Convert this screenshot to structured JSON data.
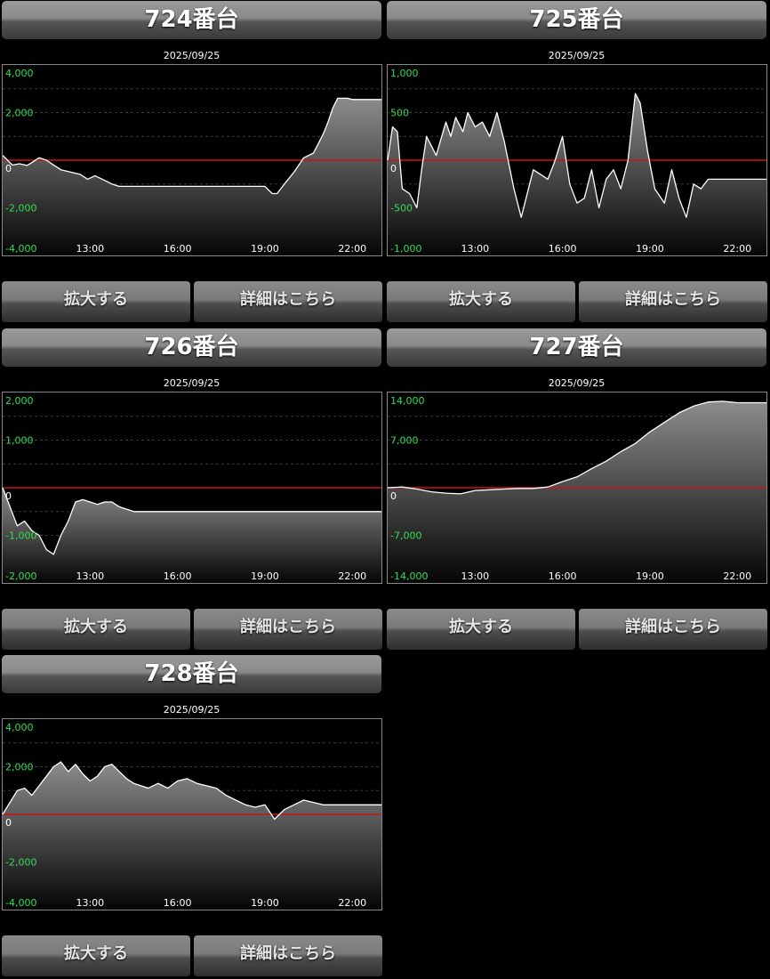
{
  "buttons": {
    "zoom": "拡大する",
    "detail": "詳細はこちら"
  },
  "colors": {
    "ytick": "#33dd55",
    "zero_line": "#c81414",
    "grid": "#3a3a3a",
    "series": "#ffffff",
    "title_text": "#ffffff"
  },
  "panels": [
    {
      "title": "724番台",
      "date": "2025/09/25",
      "chart_data": {
        "type": "area",
        "title": "724番台",
        "date": "2025/09/25",
        "x_ticks": [
          "13:00",
          "16:00",
          "19:00",
          "22:00"
        ],
        "x_range": [
          "10:00",
          "23:00"
        ],
        "y_ticks": [
          4000,
          2000,
          0,
          -2000,
          -4000
        ],
        "y_tick_labels": [
          "4,000",
          "2,000",
          "0",
          "-2,000",
          "-4,000"
        ],
        "ylim": [
          -4000,
          4000
        ],
        "grid": true,
        "zero_line": true,
        "x": [
          "10:00",
          "10:20",
          "10:35",
          "10:50",
          "11:00",
          "11:15",
          "11:30",
          "11:45",
          "12:00",
          "12:20",
          "12:40",
          "12:55",
          "13:10",
          "13:30",
          "13:45",
          "14:00",
          "15:00",
          "16:00",
          "17:00",
          "18:00",
          "19:00",
          "19:15",
          "19:25",
          "19:40",
          "20:00",
          "20:20",
          "20:40",
          "20:50",
          "21:00",
          "21:10",
          "21:20",
          "21:30",
          "21:50",
          "22:00",
          "22:30",
          "23:00"
        ],
        "y": [
          200,
          -200,
          -150,
          -220,
          -100,
          100,
          0,
          -200,
          -400,
          -500,
          -600,
          -800,
          -650,
          -850,
          -1000,
          -1100,
          -1100,
          -1100,
          -1100,
          -1100,
          -1100,
          -1400,
          -1400,
          -1000,
          -500,
          100,
          300,
          700,
          1100,
          1600,
          2200,
          2600,
          2600,
          2550,
          2550,
          2550
        ]
      }
    },
    {
      "title": "725番台",
      "date": "2025/09/25",
      "chart_data": {
        "type": "area",
        "title": "725番台",
        "date": "2025/09/25",
        "x_ticks": [
          "13:00",
          "16:00",
          "19:00",
          "22:00"
        ],
        "x_range": [
          "10:00",
          "23:00"
        ],
        "y_ticks": [
          1000,
          500,
          0,
          -500,
          -1000
        ],
        "y_tick_labels": [
          "1,000",
          "500",
          "0",
          "-500",
          "-1,000"
        ],
        "ylim": [
          -1000,
          1000
        ],
        "grid": true,
        "zero_line": true,
        "x": [
          "10:00",
          "10:10",
          "10:20",
          "10:30",
          "10:45",
          "11:00",
          "11:10",
          "11:20",
          "11:40",
          "12:00",
          "12:10",
          "12:20",
          "12:35",
          "12:45",
          "13:00",
          "13:15",
          "13:30",
          "13:45",
          "14:00",
          "14:20",
          "14:35",
          "15:00",
          "15:30",
          "15:45",
          "16:00",
          "16:15",
          "16:30",
          "16:45",
          "17:00",
          "17:15",
          "17:30",
          "17:45",
          "18:00",
          "18:15",
          "18:30",
          "18:40",
          "18:55",
          "19:10",
          "19:30",
          "19:45",
          "20:00",
          "20:15",
          "20:30",
          "20:45",
          "21:00",
          "21:15",
          "21:30",
          "23:00"
        ],
        "y": [
          0,
          350,
          300,
          -300,
          -350,
          -500,
          -100,
          250,
          50,
          400,
          250,
          450,
          300,
          500,
          350,
          400,
          250,
          500,
          200,
          -300,
          -600,
          -100,
          -200,
          0,
          250,
          -250,
          -450,
          -400,
          -100,
          -500,
          -200,
          -100,
          -300,
          0,
          700,
          600,
          100,
          -300,
          -450,
          -100,
          -400,
          -600,
          -250,
          -300,
          -200,
          -200,
          -200,
          -200
        ]
      }
    },
    {
      "title": "726番台",
      "date": "2025/09/25",
      "chart_data": {
        "type": "area",
        "title": "726番台",
        "date": "2025/09/25",
        "x_ticks": [
          "13:00",
          "16:00",
          "19:00",
          "22:00"
        ],
        "x_range": [
          "10:00",
          "23:00"
        ],
        "y_ticks": [
          2000,
          1000,
          0,
          -1000,
          -2000
        ],
        "y_tick_labels": [
          "2,000",
          "1,000",
          "0",
          "-1,000",
          "-2,000"
        ],
        "ylim": [
          -2000,
          2000
        ],
        "grid": true,
        "zero_line": true,
        "x": [
          "10:00",
          "10:15",
          "10:30",
          "10:45",
          "11:00",
          "11:15",
          "11:30",
          "11:45",
          "12:00",
          "12:15",
          "12:30",
          "12:45",
          "13:00",
          "13:15",
          "13:30",
          "13:45",
          "14:00",
          "14:15",
          "14:30",
          "15:00",
          "16:00",
          "17:00",
          "18:00",
          "19:00",
          "20:00",
          "21:00",
          "22:00",
          "23:00"
        ],
        "y": [
          0,
          -400,
          -800,
          -700,
          -900,
          -1000,
          -1300,
          -1400,
          -1000,
          -700,
          -300,
          -250,
          -300,
          -350,
          -300,
          -300,
          -400,
          -450,
          -500,
          -500,
          -500,
          -500,
          -500,
          -500,
          -500,
          -500,
          -500,
          -500
        ]
      }
    },
    {
      "title": "727番台",
      "date": "2025/09/25",
      "chart_data": {
        "type": "area",
        "title": "727番台",
        "date": "2025/09/25",
        "x_ticks": [
          "13:00",
          "16:00",
          "19:00",
          "22:00"
        ],
        "x_range": [
          "10:00",
          "23:00"
        ],
        "y_ticks": [
          14000,
          7000,
          0,
          -7000,
          -14000
        ],
        "y_tick_labels": [
          "14,000",
          "7,000",
          "0",
          "-7,000",
          "-14,000"
        ],
        "ylim": [
          -14000,
          14000
        ],
        "grid": true,
        "zero_line": true,
        "x": [
          "10:00",
          "10:30",
          "11:00",
          "11:30",
          "12:00",
          "12:30",
          "13:00",
          "13:30",
          "14:00",
          "14:30",
          "15:00",
          "15:30",
          "16:00",
          "16:30",
          "17:00",
          "17:30",
          "18:00",
          "18:30",
          "19:00",
          "19:30",
          "20:00",
          "20:30",
          "21:00",
          "21:30",
          "22:00",
          "23:00"
        ],
        "y": [
          0,
          100,
          -200,
          -600,
          -800,
          -900,
          -400,
          -300,
          -200,
          -100,
          -100,
          100,
          900,
          1600,
          2800,
          3900,
          5300,
          6500,
          8200,
          9600,
          11000,
          12000,
          12600,
          12700,
          12500,
          12500
        ]
      }
    },
    {
      "title": "728番台",
      "date": "2025/09/25",
      "chart_data": {
        "type": "area",
        "title": "728番台",
        "date": "2025/09/25",
        "x_ticks": [
          "13:00",
          "16:00",
          "19:00",
          "22:00"
        ],
        "x_range": [
          "10:00",
          "23:00"
        ],
        "y_ticks": [
          4000,
          2000,
          0,
          -2000,
          -4000
        ],
        "y_tick_labels": [
          "4,000",
          "2,000",
          "0",
          "-2,000",
          "-4,000"
        ],
        "ylim": [
          -4000,
          4000
        ],
        "grid": true,
        "zero_line": true,
        "x": [
          "10:00",
          "10:15",
          "10:30",
          "10:45",
          "11:00",
          "11:15",
          "11:30",
          "11:45",
          "12:00",
          "12:15",
          "12:30",
          "12:45",
          "13:00",
          "13:15",
          "13:30",
          "13:45",
          "14:00",
          "14:15",
          "14:30",
          "14:45",
          "15:00",
          "15:20",
          "15:40",
          "16:00",
          "16:20",
          "16:40",
          "17:00",
          "17:20",
          "17:40",
          "18:00",
          "18:20",
          "18:40",
          "19:00",
          "19:20",
          "19:40",
          "20:00",
          "20:20",
          "20:40",
          "21:00",
          "23:00"
        ],
        "y": [
          0,
          500,
          1000,
          1100,
          800,
          1200,
          1600,
          2000,
          2200,
          1800,
          2100,
          1700,
          1400,
          1600,
          2000,
          2100,
          1800,
          1500,
          1300,
          1200,
          1100,
          1300,
          1100,
          1400,
          1500,
          1300,
          1200,
          1100,
          800,
          600,
          400,
          300,
          400,
          -200,
          200,
          400,
          600,
          500,
          400,
          400
        ]
      }
    }
  ]
}
